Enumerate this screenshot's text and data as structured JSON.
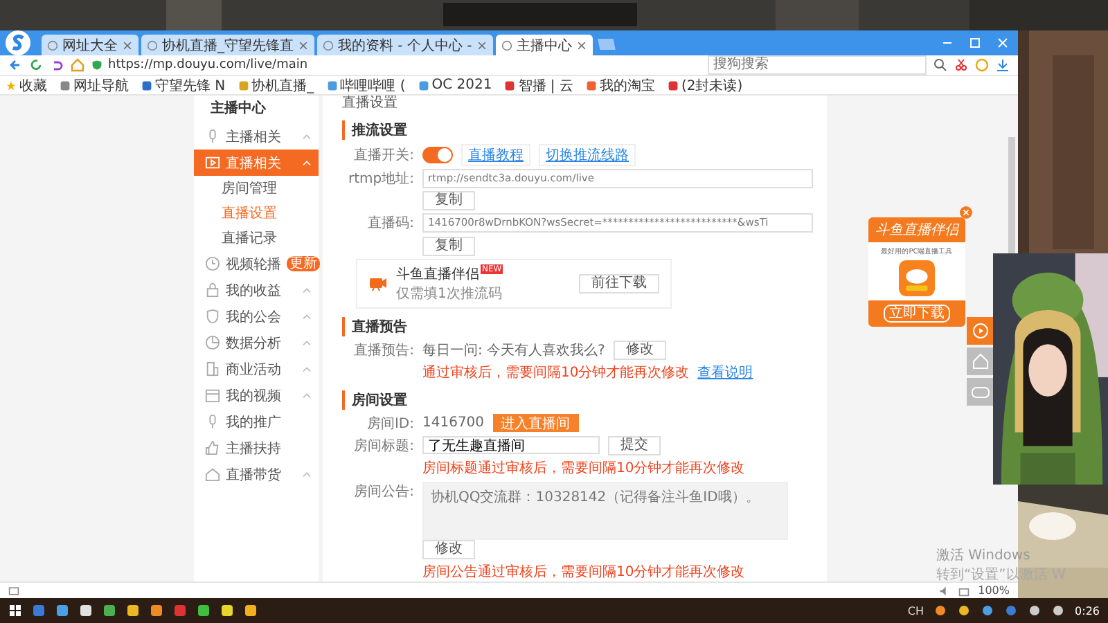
{
  "browser": {
    "tabs": [
      {
        "title": "网址大全",
        "selected": false
      },
      {
        "title": "协机直播_守望先锋直",
        "selected": false
      },
      {
        "title": "我的资料 - 个人中心 -",
        "selected": false
      },
      {
        "title": "主播中心",
        "selected": true
      }
    ],
    "url": "https://mp.douyu.com/live/main",
    "search_placeholder": "搜狗搜索",
    "bookmarks": [
      "收藏",
      "网址导航",
      "守望先锋 N",
      "协机直播_",
      "哔哩哔哩 (",
      "OC 2021",
      "智播 | 云",
      "我的淘宝",
      "(2封未读)"
    ],
    "zoom": "100%"
  },
  "sidebar": {
    "title": "主播中心",
    "items": [
      {
        "label": "主播相关",
        "selected": false,
        "expandable": true
      },
      {
        "label": "直播相关",
        "selected": true,
        "expandable": true,
        "children": [
          {
            "label": "房间管理",
            "selected": false
          },
          {
            "label": "直播设置",
            "selected": true
          },
          {
            "label": "直播记录",
            "selected": false
          }
        ]
      },
      {
        "label": "视频轮播",
        "selected": false,
        "expandable": false,
        "badge": "更新"
      },
      {
        "label": "我的收益",
        "selected": false,
        "expandable": true
      },
      {
        "label": "我的公会",
        "selected": false,
        "expandable": true
      },
      {
        "label": "数据分析",
        "selected": false,
        "expandable": true
      },
      {
        "label": "商业活动",
        "selected": false,
        "expandable": true
      },
      {
        "label": "我的视频",
        "selected": false,
        "expandable": true
      },
      {
        "label": "我的推广",
        "selected": false,
        "expandable": false
      },
      {
        "label": "主播扶持",
        "selected": false,
        "expandable": false
      },
      {
        "label": "直播带货",
        "selected": false,
        "expandable": true
      }
    ]
  },
  "page_title": "直播设置",
  "push": {
    "heading": "推流设置",
    "switch_label": "直播开关:",
    "on": true,
    "links": [
      "直播教程",
      "切换推流线路"
    ],
    "fields": [
      {
        "label": "rtmp地址:",
        "value": "rtmp://sendtc3a.douyu.com/live",
        "button": "复制"
      },
      {
        "label": "直播码:",
        "value": "1416700r8wDrnbKON?wsSecret=**************************&wsTi",
        "button": "复制"
      }
    ],
    "promo": {
      "title": "斗鱼直播伴侣",
      "badge": "NEW",
      "subtitle": "仅需填1次推流码",
      "button": "前往下载"
    }
  },
  "notice": {
    "heading": "直播预告",
    "label": "直播预告:",
    "value": "每日一问: 今天有人喜欢我么?",
    "button": "修改",
    "warning": "通过审核后，需要间隔10分钟才能再次修改",
    "link": "查看说明"
  },
  "room": {
    "heading": "房间设置",
    "id_label": "房间ID:",
    "id": "1416700",
    "enter_button": "进入直播间",
    "title_label": "房间标题:",
    "title_value": "了无生趣直播间",
    "submit_button": "提交",
    "title_warning": "房间标题通过审核后，需要间隔10分钟才能再次修改",
    "announce_label": "房间公告:",
    "announce_value": "协机QQ交流群：10328142（记得备注斗鱼ID哦）。",
    "announce_button": "修改",
    "announce_warning": "房间公告通过审核后，需要间隔10分钟才能再次修改"
  },
  "ad": {
    "title": "斗鱼直播伴侣",
    "subtitle": "最好用的PC端直播工具",
    "button": "立即下载"
  },
  "watermark": [
    "激活 Windows",
    "转到“设置”以激活 W"
  ],
  "taskbar": {
    "ime": "CH",
    "clock": "0:26"
  }
}
